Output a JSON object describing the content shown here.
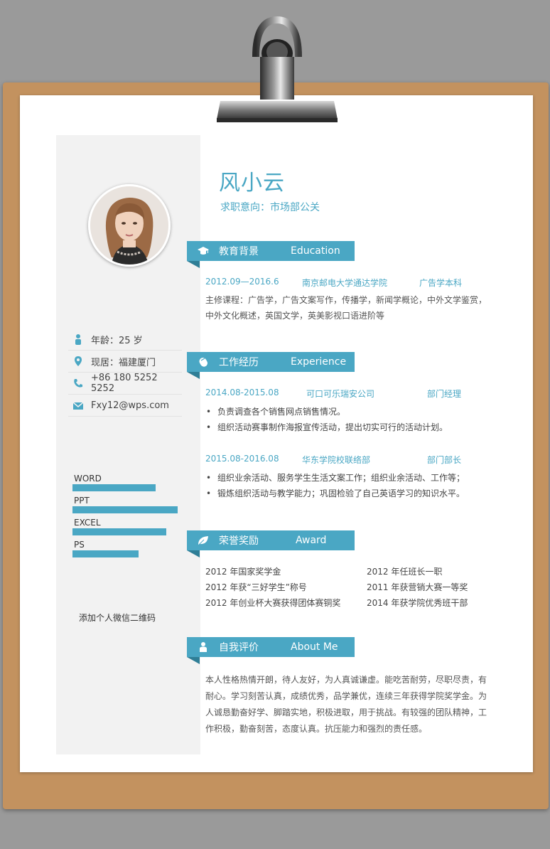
{
  "profile": {
    "name": "风小云",
    "intent": "求职意向：市场部公关"
  },
  "contact": [
    {
      "icon": "person-icon",
      "text": "年龄：25 岁"
    },
    {
      "icon": "location-pin-icon",
      "text": "现居：福建厦门"
    },
    {
      "icon": "phone-icon",
      "text": "+86 180 5252 5252"
    },
    {
      "icon": "mail-icon",
      "text": "Fxy12@wps.com"
    }
  ],
  "skills": [
    {
      "label": "WORD",
      "level": 0.79
    },
    {
      "label": "PPT",
      "level": 1.0
    },
    {
      "label": "EXCEL",
      "level": 0.89
    },
    {
      "label": "PS",
      "level": 0.63
    }
  ],
  "qr_text": "添加个人微信二维码",
  "education": {
    "title_cn": "教育背景",
    "title_en": "Education",
    "period": "2012.09—2016.6",
    "school": "南京邮电大学通达学院",
    "degree": "广告学本科",
    "lines": [
      "主修课程：广告学，广告文案写作，传播学，新闻学概论，中外文学鉴赏，",
      "中外文化概述，英国文学，英美影视口语进阶等"
    ]
  },
  "work": {
    "title_cn": "工作经历",
    "title_en": "Experience",
    "jobs": [
      {
        "period": "2014.08-2015.08",
        "org": "可口可乐瑞安公司",
        "role": "部门经理",
        "bullets": [
          "负责调查各个销售网点销售情况。",
          "组织活动赛事制作海报宣传活动，提出切实可行的活动计划。"
        ]
      },
      {
        "period": "2015.08-2016.08",
        "org": "华东学院校联络部",
        "role": "部门部长",
        "bullets": [
          "组织业余活动、服务学生生活文案工作；组织业余活动、工作等；",
          "锻炼组织活动与教学能力；巩固检验了自己英语学习的知识水平。"
        ]
      }
    ]
  },
  "awards": {
    "title_cn": "荣誉奖励",
    "title_en": "Award",
    "left": [
      "2012 年国家奖学金",
      "2012 年获“三好学生”称号",
      "2012 年创业杯大赛获得团体赛铜奖"
    ],
    "right": [
      "2012 年任班长一职",
      "2011 年获营销大赛一等奖",
      "2014 年获学院优秀班干部"
    ]
  },
  "about": {
    "title_cn": "自我评价",
    "title_en": "About Me",
    "lines": [
      "本人性格热情开朗，待人友好，为人真诚谦虚。能吃苦耐劳，尽职尽责，有",
      "耐心。学习刻苦认真，成绩优秀，品学兼优，连续三年获得学院奖学金。为",
      "人诚恳勤奋好学、脚踏实地，积极进取，用于挑战。有较强的团队精神，工",
      "作积极，勤奋刻苦，态度认真。抗压能力和强烈的责任感。"
    ]
  },
  "colors": {
    "accent": "#4aa7c4",
    "board": "#c3925f"
  }
}
